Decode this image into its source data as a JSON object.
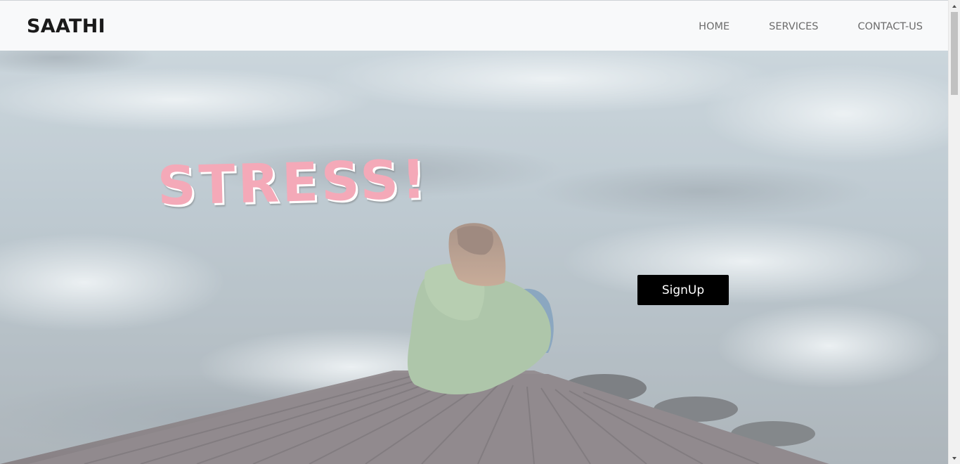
{
  "navbar": {
    "brand": "SAATHI",
    "links": [
      {
        "label": "HOME"
      },
      {
        "label": "SERVICES"
      },
      {
        "label": "CONTACT-US"
      }
    ]
  },
  "hero": {
    "headline": "STRESS!",
    "signup_label": "SignUp",
    "image": "girl-sitting-on-pier-by-lake",
    "colors": {
      "headline": "#f4a9b8",
      "button_bg": "#000000",
      "button_text": "#ffffff",
      "navbar_bg": "#f8f9fa"
    }
  },
  "scrollbar": {
    "up_icon": "scroll-up-arrow-icon",
    "down_icon": "scroll-down-arrow-icon"
  }
}
